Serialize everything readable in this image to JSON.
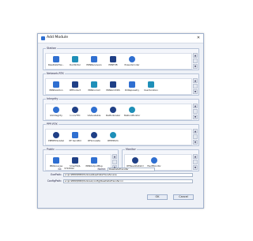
{
  "window": {
    "title": "Add Module"
  },
  "groups": {
    "station": {
      "title": "Station",
      "items": [
        {
          "label": "RawDataTrai...",
          "icon": "dataset-icon"
        },
        {
          "label": "RunWriter",
          "icon": "writer-icon"
        },
        {
          "label": "PRNReceivers",
          "icon": "receiver-icon"
        },
        {
          "label": "PRNFVB",
          "icon": "fvb-icon"
        },
        {
          "label": "PowerGrinder",
          "icon": "grinder-icon"
        }
      ]
    },
    "network": {
      "title": "Network-RTK",
      "items": [
        {
          "label": "PRNSolution",
          "icon": "solution-icon"
        },
        {
          "label": "RTProduct",
          "icon": "product-icon"
        },
        {
          "label": "PRNCorrAll",
          "icon": "correction-icon"
        },
        {
          "label": "PRNGridVRS",
          "icon": "grid-icon"
        },
        {
          "label": "DXReposetry",
          "icon": "repository-icon"
        },
        {
          "label": "UserSolution",
          "icon": "user-solution-icon"
        }
      ]
    },
    "integrity": {
      "title": "Integrity",
      "items": [
        {
          "label": "GSIntegrity",
          "icon": "integrity-icon"
        },
        {
          "label": "InnovTEC",
          "icon": "tec-icon"
        },
        {
          "label": "GSAvailable",
          "icon": "available-icon"
        },
        {
          "label": "DeModulaker",
          "icon": "demodulator-icon"
        },
        {
          "label": "StationMonitor",
          "icon": "monitor-icon"
        }
      ]
    },
    "ppp": {
      "title": "PPP-RTK",
      "items": [
        {
          "label": "PPPRTKSolutal",
          "icon": "ppp-solution-icon"
        },
        {
          "label": "RT ServBld",
          "icon": "server-icon"
        },
        {
          "label": "RTSimulate",
          "icon": "simulate-icon"
        },
        {
          "label": "RTPPPInfo",
          "icon": "info-icon"
        }
      ]
    },
    "public": {
      "title": "Public",
      "items": [
        {
          "label": "PRNLicense",
          "icon": "license-icon"
        },
        {
          "label": "SmartSQL",
          "icon": "sql-icon"
        },
        {
          "label": "PRNOutputMsg",
          "icon": "output-icon"
        }
      ]
    },
    "monitor": {
      "title": "Monitor",
      "items": [
        {
          "label": "RTBaseStatistcl",
          "icon": "statistics-icon"
        },
        {
          "label": "FaultMonitor",
          "icon": "fault-icon"
        }
      ]
    }
  },
  "fields": {
    "id": {
      "label": "ID:",
      "prefix": "3724562",
      "name_label": "Name:",
      "name_value": "RawDataTransfer"
    },
    "exe_path": {
      "label": "ExePath:",
      "value": "e:\\prnPRN\\PRN\\Modules\\RawDataTransfer.exe"
    },
    "config_path": {
      "label": "ConfigPath:",
      "value": "e:\\prnPRN\\PRN\\Modules\\config\\RawDataTransfer.ini"
    }
  },
  "buttons": {
    "ok": "OK",
    "cancel": "Cancel"
  },
  "colors": {
    "accent": "#2f6fd1",
    "frame": "#9fb0cc"
  }
}
